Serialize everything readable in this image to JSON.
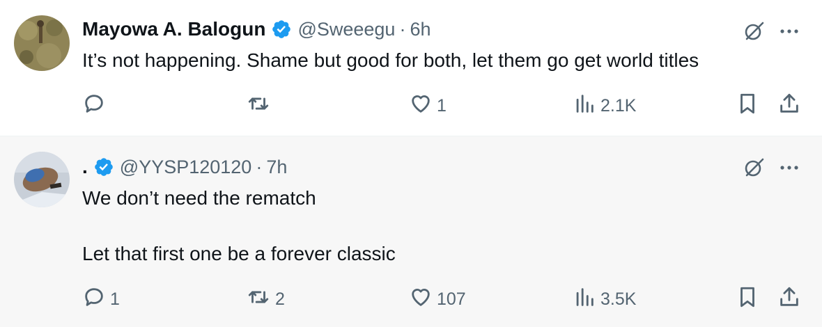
{
  "tweets": [
    {
      "name": "Mayowa A. Balogun",
      "handle": "@Sweeegu",
      "separator": "·",
      "time": "6h",
      "lines": [
        "It’s not happening. Shame but good for both, let them go get world titles"
      ],
      "stats": {
        "replies": "",
        "reposts": "",
        "likes": "1",
        "views": "2.1K"
      }
    },
    {
      "name": ".",
      "handle": "@YYSP120120",
      "separator": "·",
      "time": "7h",
      "lines": [
        "We don’t need the rematch",
        "Let that first one be a forever classic"
      ],
      "stats": {
        "replies": "1",
        "reposts": "2",
        "likes": "107",
        "views": "3.5K"
      }
    }
  ],
  "icons": {
    "verified": "verified-badge-icon",
    "grok": "grok-icon",
    "more": "more-icon",
    "reply": "reply-icon",
    "repost": "repost-icon",
    "like": "heart-icon",
    "views": "views-icon",
    "bookmark": "bookmark-icon",
    "share": "share-icon"
  },
  "colors": {
    "text_primary": "#0f1419",
    "text_secondary": "#536471",
    "verified_blue": "#1d9bf0",
    "tweet2_background": "#f7f7f7"
  }
}
